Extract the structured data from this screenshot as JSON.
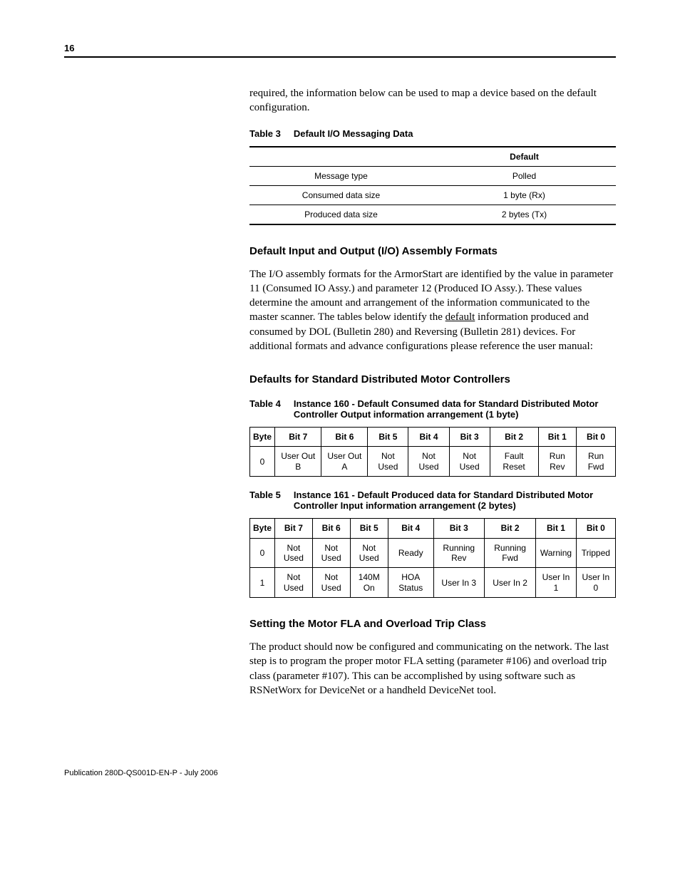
{
  "page_number": "16",
  "intro_para": "required, the information below can be used to map a device based on the default configuration.",
  "table3": {
    "label": "Table 3",
    "title": "Default I/O Messaging Data",
    "header_right": "Default",
    "rows": [
      {
        "k": "Message type",
        "v": "Polled"
      },
      {
        "k": "Consumed data size",
        "v": "1 byte (Rx)"
      },
      {
        "k": "Produced data size",
        "v": "2 bytes (Tx)"
      }
    ]
  },
  "h_assembly": "Default Input and Output (I/O) Assembly Formats",
  "assembly_para_pre": "The I/O assembly formats for the ArmorStart are identified by the value in parameter 11 (Consumed IO Assy.) and parameter 12 (Produced IO Assy.). These values determine the amount and arrangement of the information communicated to the master scanner. The tables below identify the ",
  "assembly_para_u": "default",
  "assembly_para_post": " information produced and consumed by DOL (Bulletin 280) and Reversing (Bulletin 281) devices. For additional formats and advance configurations please reference the user manual:",
  "h_defaults": "Defaults for Standard Distributed Motor Controllers",
  "table4": {
    "label": "Table 4",
    "title": "Instance 160 - Default Consumed data for Standard Distributed Motor Controller Output information arrangement (1 byte)",
    "headers": [
      "Byte",
      "Bit 7",
      "Bit 6",
      "Bit 5",
      "Bit 4",
      "Bit 3",
      "Bit 2",
      "Bit 1",
      "Bit 0"
    ],
    "rows": [
      [
        "0",
        "User Out B",
        "User Out A",
        "Not Used",
        "Not Used",
        "Not Used",
        "Fault Reset",
        "Run Rev",
        "Run Fwd"
      ]
    ]
  },
  "table5": {
    "label": "Table 5",
    "title": "Instance 161 - Default Produced data for Standard Distributed Motor Controller Input information arrangement (2 bytes)",
    "headers": [
      "Byte",
      "Bit 7",
      "Bit 6",
      "Bit 5",
      "Bit 4",
      "Bit 3",
      "Bit 2",
      "Bit 1",
      "Bit 0"
    ],
    "rows": [
      [
        "0",
        "Not Used",
        "Not Used",
        "Not Used",
        "Ready",
        "Running Rev",
        "Running Fwd",
        "Warning",
        "Tripped"
      ],
      [
        "1",
        "Not Used",
        "Not Used",
        "140M On",
        "HOA Status",
        "User In 3",
        "User In 2",
        "User In 1",
        "User In 0"
      ]
    ]
  },
  "h_fla": "Setting the Motor FLA and Overload Trip Class",
  "fla_para": "The product should now be configured and communicating on the network. The last step is to program the proper motor FLA setting (parameter #106) and overload trip class (parameter #107). This can be accomplished by using software such as RSNetWorx for DeviceNet or a handheld DeviceNet tool.",
  "footer": "Publication 280D-QS001D-EN-P - July 2006"
}
